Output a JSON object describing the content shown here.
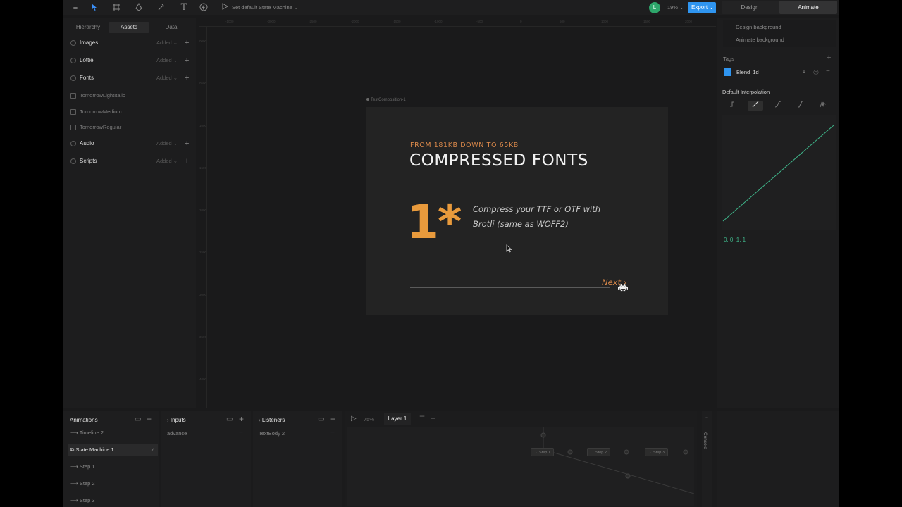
{
  "toolbar": {
    "state_machine_label": "Set default State Machine",
    "avatar_letter": "L",
    "zoom": "19%",
    "export_label": "Export",
    "mode_design": "Design",
    "mode_animate": "Animate"
  },
  "left_panel": {
    "tabs": [
      "Hierarchy",
      "Assets",
      "Data"
    ],
    "sections": {
      "images": {
        "label": "Images",
        "status": "Added"
      },
      "lottie": {
        "label": "Lottie",
        "status": "Added"
      },
      "fonts": {
        "label": "Fonts",
        "status": "Added"
      },
      "audio": {
        "label": "Audio",
        "status": "Added"
      },
      "scripts": {
        "label": "Scripts",
        "status": "Added"
      }
    },
    "font_items": [
      "TomorrowLightItalic",
      "TomorrowMedium",
      "TomorrowRegular"
    ]
  },
  "canvas": {
    "artboard_name": "TestComposition-1",
    "ruler_top": [
      "-1000",
      "-3000",
      "-2500",
      "-2000",
      "-1500",
      "-1000",
      "-500",
      "0",
      "500",
      "1000",
      "1500",
      "2000"
    ],
    "ruler_left": [
      "0000",
      "0500",
      "1000",
      "1500",
      "2000",
      "2500",
      "3000",
      "3500",
      "4000"
    ],
    "subtitle": "FROM 181KB DOWN TO 65KB",
    "title": "COMPRESSED FONTS",
    "step_number": "1*",
    "description": "Compress your TTF or OTF with Brotli (same as WOFF2)",
    "next_label": "Next ›"
  },
  "right_panel": {
    "design_background": "Design background",
    "animate_background": "Animate background",
    "tags_label": "Tags",
    "tag_name": "Blend_1d",
    "default_interpolation": "Default Interpolation",
    "curve_values": "0, 0, 1, 1"
  },
  "bottom": {
    "animations_title": "Animations",
    "animations": [
      "Timeline 2",
      "State Machine 1",
      "Step 1",
      "Step 2",
      "Step 3"
    ],
    "inputs_title": "Inputs",
    "inputs": [
      "advance"
    ],
    "listeners_title": "Listeners",
    "listeners": [
      "TextBody 2"
    ],
    "graph_zoom": "75%",
    "layer_tab": "Layer 1",
    "nodes": [
      "Step 1",
      "Step 2",
      "Step 3"
    ],
    "console_label": "Console"
  },
  "colors": {
    "accent_orange": "#e89a3c",
    "accent_blue": "#2f95f0",
    "curve_green": "#3fb58a"
  }
}
